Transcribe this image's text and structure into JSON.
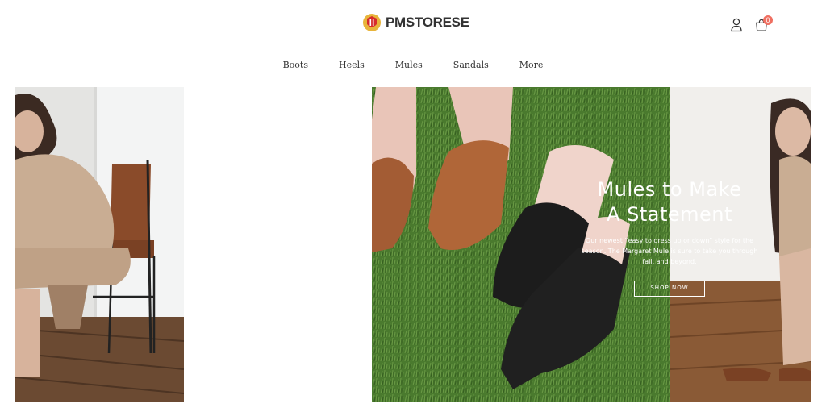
{
  "header": {
    "logo_text": "PMSTORESE",
    "account_icon": "user-icon",
    "cart_icon": "shopping-bag-icon",
    "cart_count": "0"
  },
  "nav": {
    "items": [
      {
        "label": "Boots"
      },
      {
        "label": "Heels"
      },
      {
        "label": "Mules"
      },
      {
        "label": "Sandals"
      },
      {
        "label": "More"
      }
    ]
  },
  "hero": {
    "title_line1": "Mules to Make",
    "title_line2": "A Statement",
    "body": "Our newest “easy to dress up or down” style for the season. The Margaret Mule is sure to take you through fall, and beyond.",
    "button_label": "SHOP NOW"
  },
  "colors": {
    "badge": "#ef6f61",
    "logo_red": "#d62b2b",
    "logo_gold": "#e8b43a",
    "grass": "#4a7a2e"
  }
}
